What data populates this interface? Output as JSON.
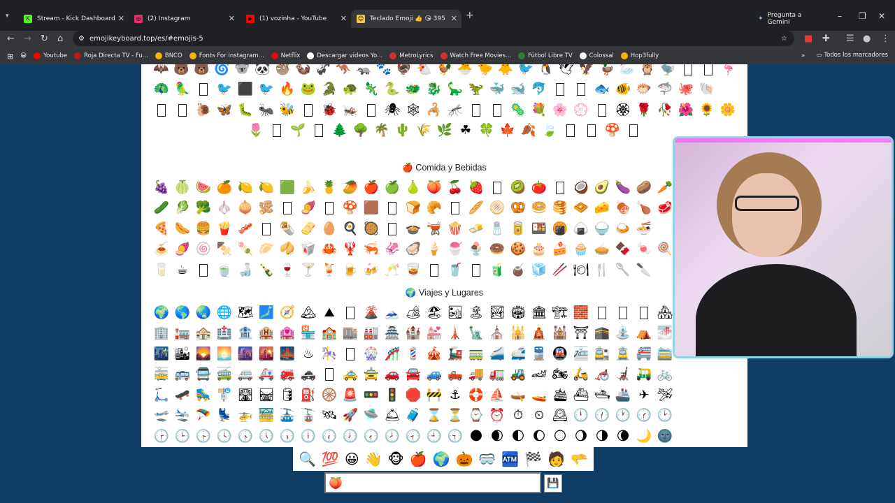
{
  "tabs": [
    {
      "title": "Stream - Kick Dashboard",
      "color": "#53fc18",
      "glyph": "K"
    },
    {
      "title": "(2) Instagram",
      "color": "#e1306c",
      "glyph": "◎"
    },
    {
      "title": "(1) vozinha - YouTube",
      "color": "#ff0000",
      "glyph": "▶"
    },
    {
      "title": "Teclado Emoji 👍 😘 395",
      "color": "#f2c94c",
      "glyph": "☺"
    }
  ],
  "gemini_label": "Pregunta a Gemini",
  "url": "emojikeyboard.top/es/#emojis-5",
  "bookmarks": [
    {
      "label": "Youtube",
      "color": "#ff0000"
    },
    {
      "label": "Roja Directa TV - Fu...",
      "color": "#b71c1c"
    },
    {
      "label": "BNCO",
      "color": "#f0b400"
    },
    {
      "label": "Fonts For Instagram...",
      "color": "#f0b400"
    },
    {
      "label": "Netflix",
      "color": "#e50914"
    },
    {
      "label": "Descargar videos Yo...",
      "color": "#ffffff"
    },
    {
      "label": "MetroLyrics",
      "color": "#d32f2f"
    },
    {
      "label": "Watch Free Movies...",
      "color": "#d32f2f"
    },
    {
      "label": "Fútbol Libre TV",
      "color": "#2e7d32"
    },
    {
      "label": "Colossal",
      "color": "#ffffff"
    },
    {
      "label": "Hop3fully",
      "color": "#f0b400"
    }
  ],
  "bookmarks_all": "Todos los marcadores",
  "sections": {
    "food_title": "Comida y Bebidas",
    "travel_title": "Viajes y Lugares"
  },
  "emoji_rows": {
    "animals": [
      "🦇🐻🐻🌀🐨🐼🦥🦦🦨🦘🦡🐾🦃🐔🐓🐣🐤🐥🐦🐧🕊🦅🦆🦢🦉🦤▯▯🦩",
      "🦚🦜▯🐦⬛🐦🔥🐸🐊🐢🦎🐍🐲🐉🦕🦖🐳🐋🐬▯▯🐟🐠🐡🦈🐙🐚",
      "▯▯🐌🦋🐛🐜🐝▯🐞🦗▯🕷🕸🦂🦟▯▯🦠💐🌸💮▯🏵🌹🥀🌺🌻🌼",
      "🌷▯🌱▯🌲🌳🌴🌵🌾🌿☘🍀🍁🍂🍃▯▯🍄▯"
    ],
    "food": [
      "🍇🍈🍉🍊🍋🍋🟩🍌🍍🥭🍎🍏🍐🍑🍒🍓▯🥝🍅▯🥥🥑🍆🥔🥕",
      "🥒🥬🥦🧄🧅🫚▯🍠▯🍄🟫▯🍞🥐▯🥖🫓🥨🥯🥞🧇🧀🍖🍗🥩",
      "🍕🌭🍔🍟🥓▯🌯🫔🥚🍳🥘▯🍲🫕🍿🧈🧂🥫🍱🍘🍙🍚🍛🍜",
      "🍝🍠🍥🍢🍡🥟🥠🥡🦀🦞🦐🦑🦪🍦🍧🍨🍩🍪🎂🍰🧁🥧🍫🍬🍭",
      "🥛☕▯🍵🍶🍾🍷🍸🍹🍺🍻🥂🥃▯🥤▯🧃🧉🧊🥢🍽🍴🥄🔪"
    ],
    "travel": [
      "🌍🌎🌏🌐🗺🗾🧭🏔⛰▯🌋🗻🏕🏖🏜🏝🏞🏟🏛🏗🧱▯▯▯🏘",
      "🏢🏣🏤🏥🏦🏨🏩🏪🏫🏬🏭🏯🏰💒🗼🗽⛪🕌🛕🕍⛩🕋⛲⛺🌁",
      "🌃🏙🌄🌅🌆🌇🌉♨🎠▯🎡🎢💈🎪🚂🚃🚄🚅🚆🚇🚈🚉🚊🚝🚞",
      "🚋🚌🚍🚎🚐🚑🚒🚓▯🚕🚖🚗🚘🚙🛻🚚🚛🚜🏎🏍🛵🦽🦼🛺🚲",
      "🛴🛹🛼🚏🛣🛤🛢⛽🛞🚨🚥🚦🛑🚧⚓🛟⛵🛶🚤🛳⛴🛥🚢✈🛩",
      "🛫🛬🪂💺🚁🚟🚠🚡🛰🚀🛸🛎🧳⌛⏳⌚⏰⏱⏲🕰🕛🕧🕐🕜🕑",
      "🕝🕒🕞🕓🕟🕔🕠🕕🕡🕖🕢🕗🕣🕘🕤🌑🌒🌓🌔🌕🌖🌗🌘🌙🌚"
    ]
  },
  "bottom_tabs": [
    "🔍",
    "💯",
    "😀",
    "👋",
    "🐵",
    "🍎",
    "🌍",
    "🎃",
    "🥽",
    "🏧",
    "🏁",
    "🧑",
    "🫳"
  ],
  "input_icon": "🍑",
  "save_icon": "💾"
}
